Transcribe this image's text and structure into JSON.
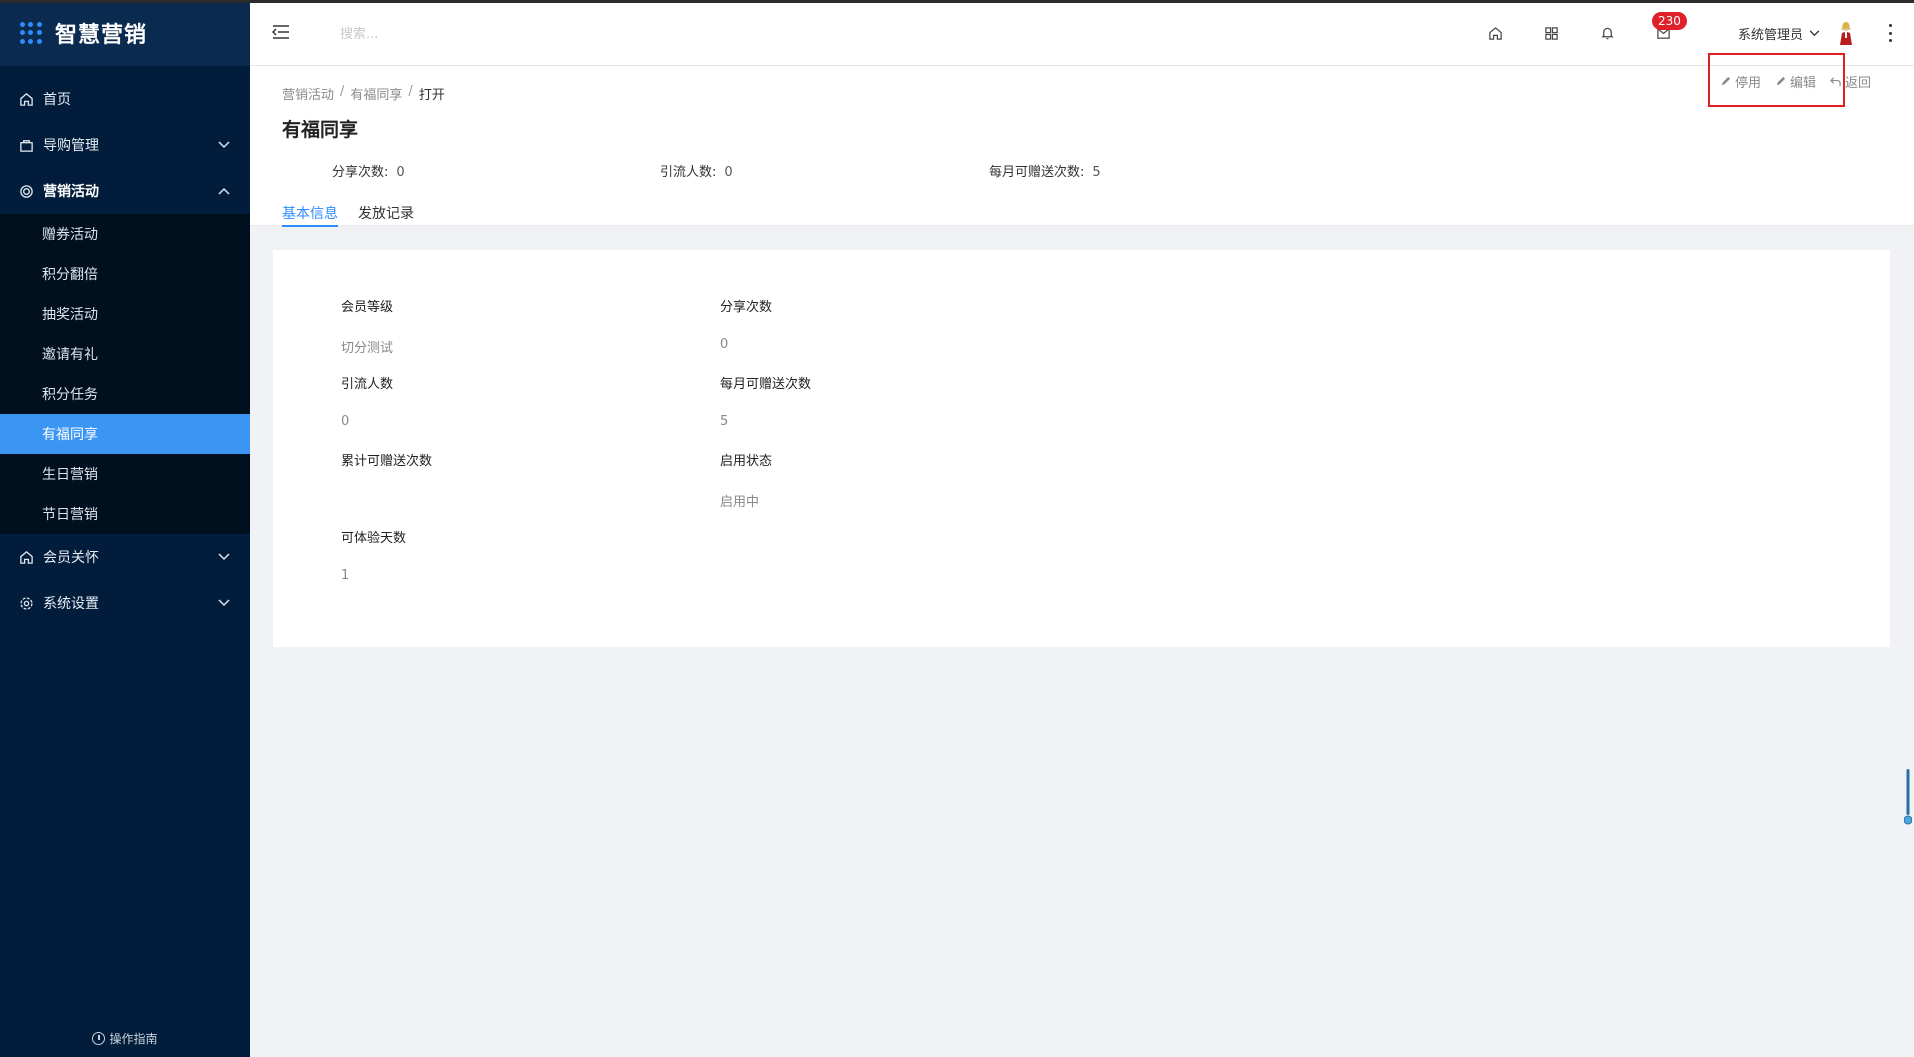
{
  "logo": {
    "text": "智慧营销"
  },
  "sidebar": {
    "items": [
      {
        "label": "首页",
        "icon": "home-icon"
      },
      {
        "label": "导购管理",
        "icon": "bag-icon"
      },
      {
        "label": "营销活动",
        "icon": "target-icon"
      }
    ],
    "submenu": [
      {
        "label": "赠券活动"
      },
      {
        "label": "积分翻倍"
      },
      {
        "label": "抽奖活动"
      },
      {
        "label": "邀请有礼"
      },
      {
        "label": "积分任务"
      },
      {
        "label": "有福同享"
      },
      {
        "label": "生日营销"
      },
      {
        "label": "节日营销"
      }
    ],
    "bottom_items": [
      {
        "label": "会员关怀",
        "icon": "home-icon"
      },
      {
        "label": "系统设置",
        "icon": "gear-icon"
      }
    ],
    "guide": "操作指南"
  },
  "header": {
    "search_placeholder": "搜索...",
    "badge": "230",
    "user": "系统管理员"
  },
  "breadcrumb": [
    "营销活动",
    "有福同享",
    "打开"
  ],
  "page_title": "有福同享",
  "stats": [
    {
      "label": "分享次数:",
      "value": "0"
    },
    {
      "label": "引流人数:",
      "value": "0"
    },
    {
      "label": "每月可赠送次数:",
      "value": "5"
    }
  ],
  "tabs": [
    "基本信息",
    "发放记录"
  ],
  "actions": {
    "disable": "停用",
    "edit": "编辑",
    "back": "返回"
  },
  "fields": [
    {
      "label": "会员等级",
      "value": "切分测试"
    },
    {
      "label": "分享次数",
      "value": "0"
    },
    {
      "label": "引流人数",
      "value": "0"
    },
    {
      "label": "每月可赠送次数",
      "value": "5"
    },
    {
      "label": "累计可赠送次数",
      "value": ""
    },
    {
      "label": "启用状态",
      "value": "启用中"
    },
    {
      "label": "可体验天数",
      "value": "1"
    }
  ],
  "colors": {
    "sidebar_bg": "#021d3b",
    "accent": "#3a95f3",
    "badge": "#e0212a",
    "highlight": "#e02020"
  }
}
